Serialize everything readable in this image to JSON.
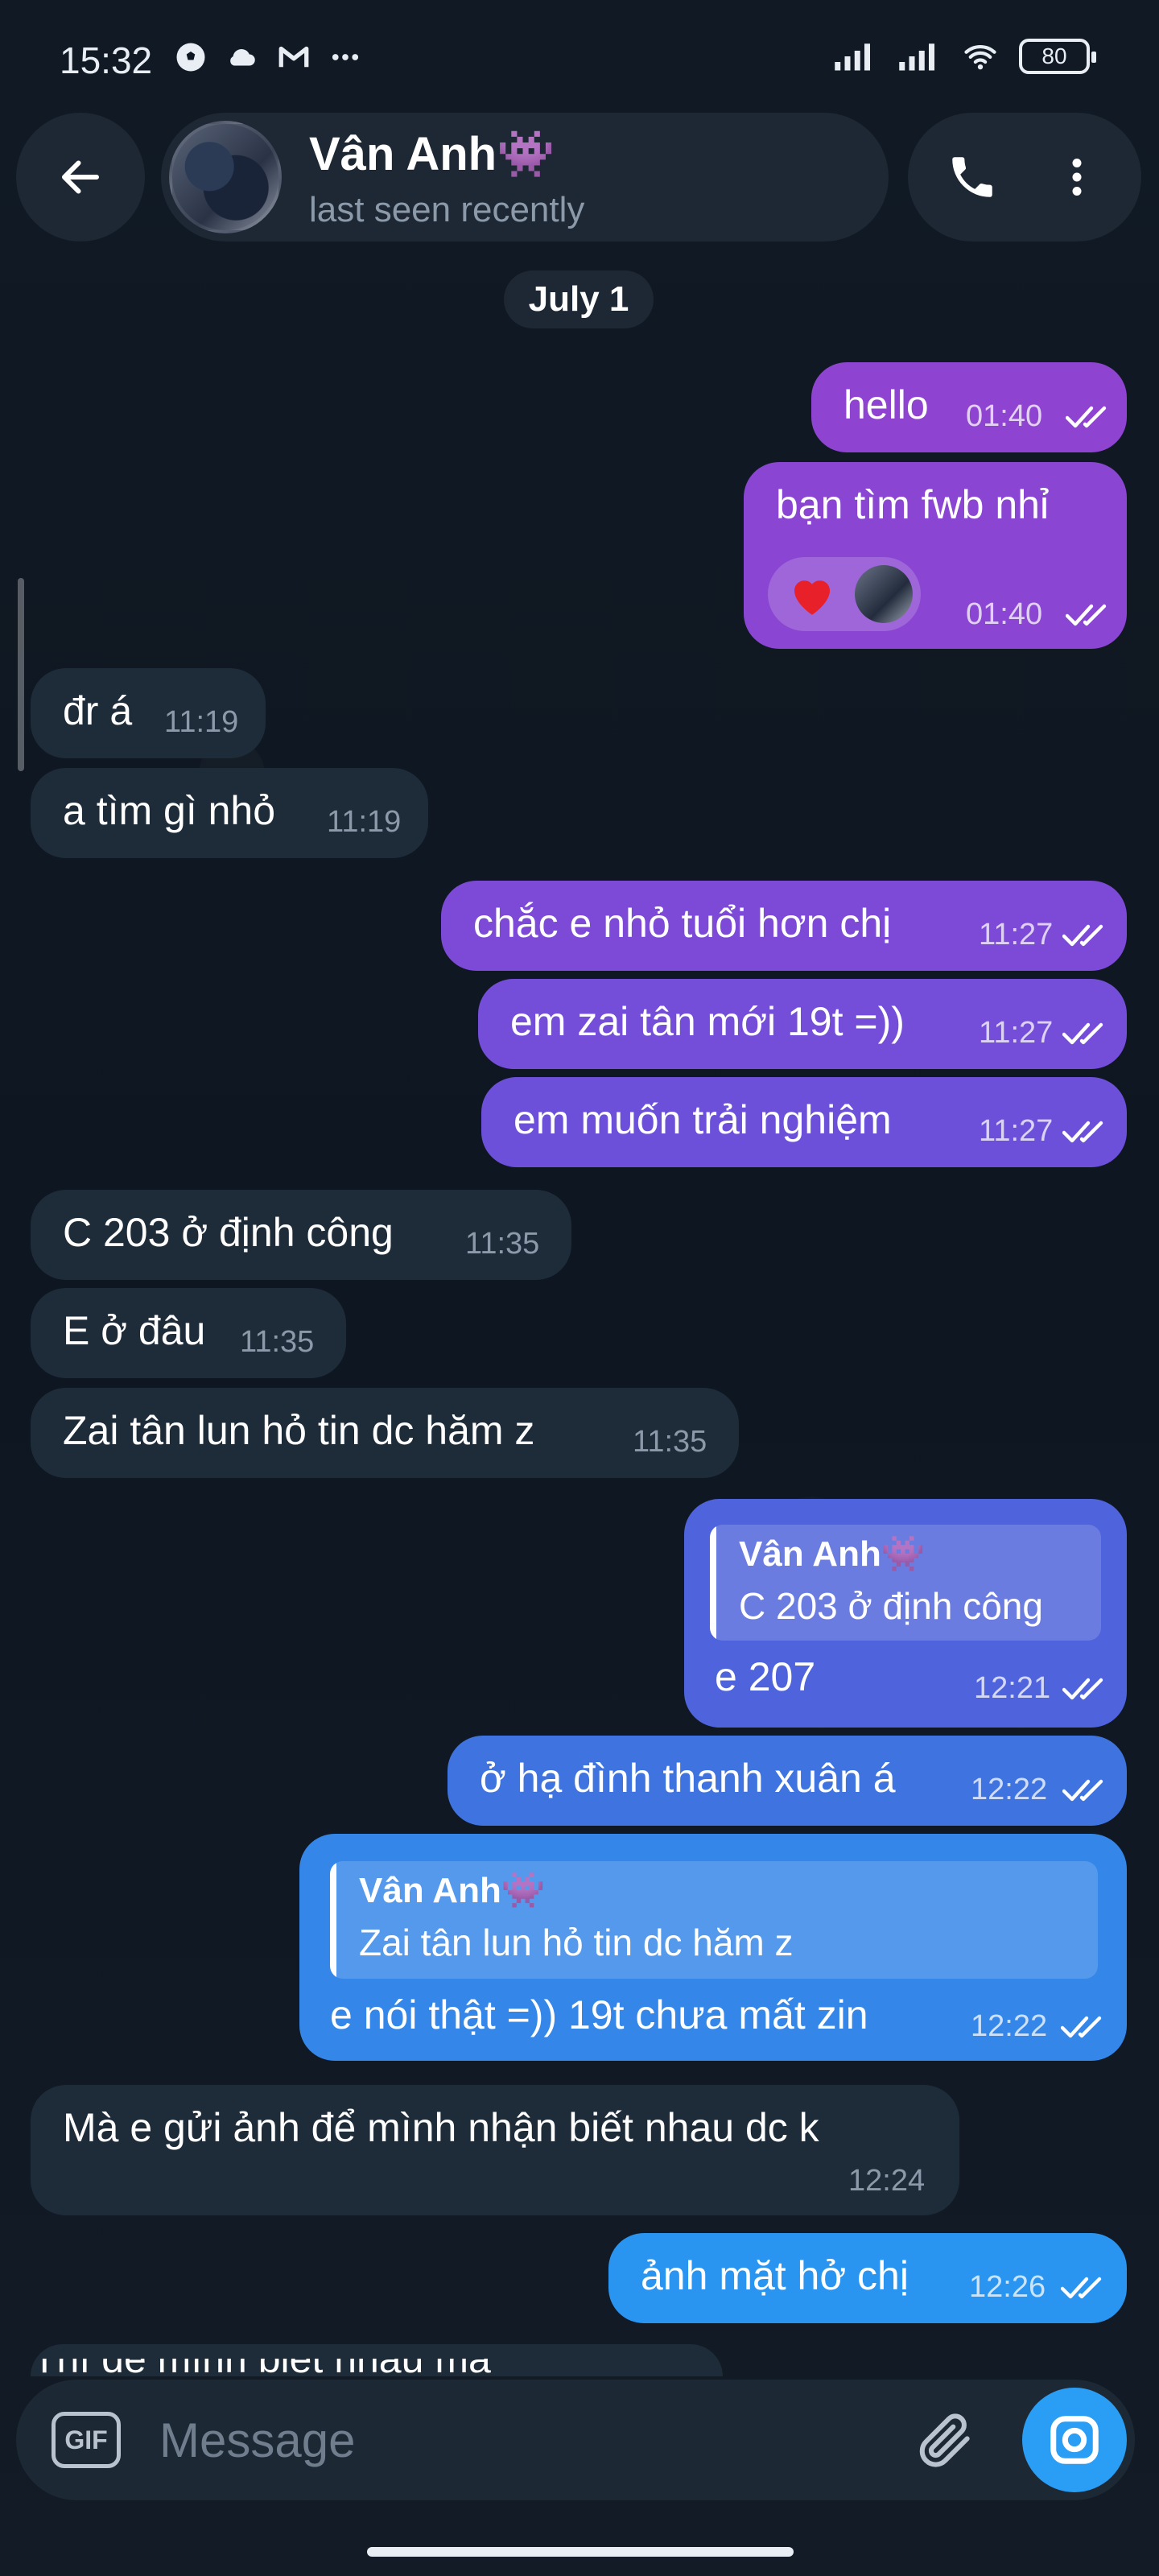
{
  "status_bar": {
    "time": "15:32",
    "battery": "80"
  },
  "header": {
    "contact_name": "Vân Anh👾",
    "status": "last seen recently"
  },
  "date_chip": "July 1",
  "messages": [
    {
      "dir": "out",
      "text": "hello",
      "time": "01:40"
    },
    {
      "dir": "out",
      "text": "bạn tìm fwb nhỉ",
      "time": "01:40",
      "reactions": [
        "heart-icon",
        "reactor-avatar"
      ]
    },
    {
      "dir": "in",
      "text": "đr á",
      "time": "11:19"
    },
    {
      "dir": "in",
      "text": "a tìm gì nhỏ",
      "time": "11:19"
    },
    {
      "dir": "out",
      "text": "chắc e nhỏ tuổi hơn chị",
      "time": "11:27"
    },
    {
      "dir": "out",
      "text": "em zai tân mới 19t =))",
      "time": "11:27"
    },
    {
      "dir": "out",
      "text": "em muốn trải nghiệm",
      "time": "11:27"
    },
    {
      "dir": "in",
      "text": "C 203 ở định công",
      "time": "11:35"
    },
    {
      "dir": "in",
      "text": "E ở đâu",
      "time": "11:35"
    },
    {
      "dir": "in",
      "text": "Zai tân lun hỏ tin dc hăm z",
      "time": "11:35"
    },
    {
      "dir": "out",
      "reply_name": "Vân Anh👾",
      "reply_text": "C 203 ở định công",
      "text": "e 207",
      "time": "12:21"
    },
    {
      "dir": "out",
      "text": "ở hạ đình thanh xuân á",
      "time": "12:22"
    },
    {
      "dir": "out",
      "reply_name": "Vân Anh👾",
      "reply_text": "Zai tân lun hỏ tin dc hăm z",
      "text": "e nói thật =)) 19t chưa mất zin",
      "time": "12:22"
    },
    {
      "dir": "in",
      "text": "Mà e gửi ảnh để mình nhận biết nhau dc k",
      "time": "12:24"
    },
    {
      "dir": "out",
      "text": "ảnh mặt hở chị",
      "time": "12:26"
    },
    {
      "dir": "in",
      "text": "Thì để mình biết nhau mà",
      "time": ""
    }
  ],
  "composer": {
    "gif_label": "GIF",
    "placeholder": "Message"
  },
  "colors": {
    "background": "#0e1621",
    "incoming_bubble": "#1e2c3a",
    "outgoing_gradient": [
      "#8e44d0",
      "#6a4fd8",
      "#3c7be0",
      "#2a9df4"
    ],
    "accent": "#2a9df4"
  }
}
